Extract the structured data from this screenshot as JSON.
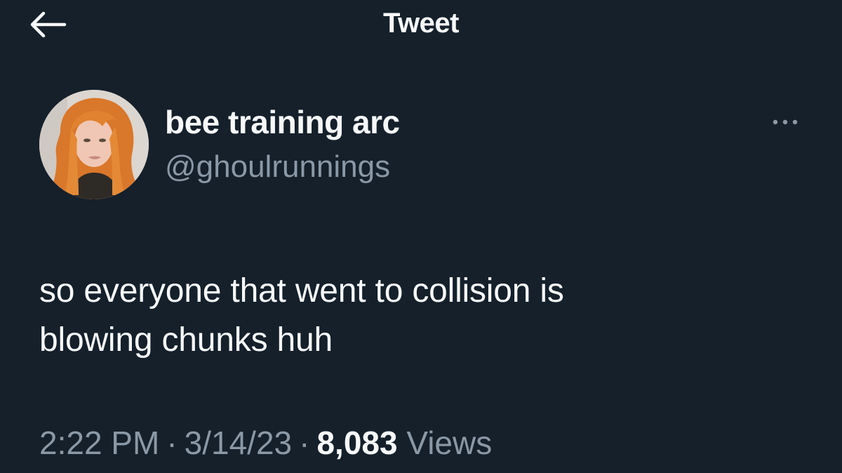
{
  "header": {
    "title": "Tweet",
    "back_icon": "arrow-left-icon"
  },
  "author": {
    "display_name": "bee training arc",
    "handle": "@ghoulrunnings",
    "avatar": "profile-photo"
  },
  "more_icon": "ellipsis-icon",
  "tweet": {
    "lines": [
      "so everyone that went to collision is",
      "blowing chunks huh"
    ]
  },
  "meta": {
    "time": "2:22 PM",
    "separator": "·",
    "date": "3/14/23",
    "views_count": "8,083",
    "views_label": "Views"
  },
  "colors": {
    "background": "#15202b",
    "primary_text": "#f7f9f9",
    "secondary_text": "#8b98a5"
  }
}
